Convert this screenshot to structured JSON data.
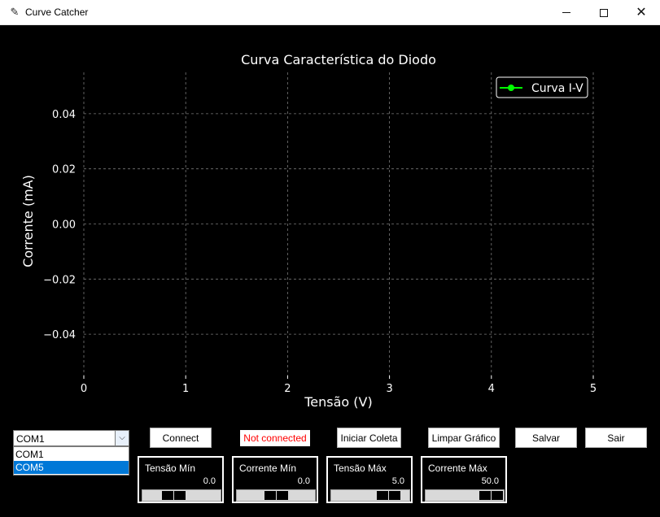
{
  "window": {
    "title": "Curve Catcher",
    "icon": "feather-icon",
    "controls": [
      "minimize-icon",
      "maximize-icon",
      "close-icon"
    ]
  },
  "chart_data": {
    "type": "line",
    "title": "Curva Característica do Diodo",
    "xlabel": "Tensão (V)",
    "ylabel": "Corrente (mA)",
    "xlim": [
      0,
      5
    ],
    "ylim": [
      -0.055,
      0.055
    ],
    "x_ticks": [
      "0",
      "1",
      "2",
      "3",
      "4",
      "5"
    ],
    "y_ticks": [
      "−0.04",
      "−0.02",
      "0.00",
      "0.02",
      "0.04"
    ],
    "grid": true,
    "legend_position": "top-right",
    "series": [
      {
        "name": "Curva I-V",
        "color": "#00ff00",
        "x": [],
        "y": []
      }
    ],
    "background": "#000000",
    "foreground": "#ffffff"
  },
  "controls": {
    "port_select": {
      "value": "COM1",
      "options": [
        "COM1",
        "COM5"
      ],
      "highlighted": "COM5"
    },
    "connect_label": "Connect",
    "status_text": "Not connected",
    "status_color": "#ff0000",
    "start_label": "Iniciar Coleta",
    "clear_label": "Limpar Gráfico",
    "save_label": "Salvar",
    "exit_label": "Sair"
  },
  "sliders": [
    {
      "label": "Tensão Mín",
      "value": "0.0",
      "fraction": 0.35
    },
    {
      "label": "Corrente Mín",
      "value": "0.0",
      "fraction": 0.5
    },
    {
      "label": "Tensão Máx",
      "value": "5.0",
      "fraction": 0.85
    },
    {
      "label": "Corrente Máx",
      "value": "50.0",
      "fraction": 1.0
    }
  ]
}
